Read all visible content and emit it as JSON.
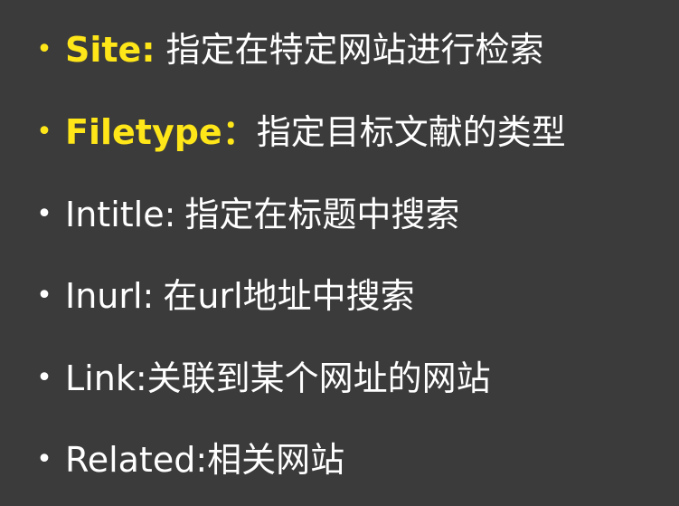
{
  "items": [
    {
      "bullet": "•",
      "keyword": "Site:",
      "text": "指定在特定网站进行检索"
    },
    {
      "bullet": "•",
      "keyword": "Filetype：",
      "text": "指定目标文献的类型"
    },
    {
      "bullet": "•",
      "keyword": "Intitle:",
      "text": "指定在标题中搜索"
    },
    {
      "bullet": "•",
      "keyword": "Inurl:",
      "text": "在url地址中搜索"
    },
    {
      "bullet": "•",
      "keyword": "Link:",
      "text": "关联到某个网址的网站"
    },
    {
      "bullet": "•",
      "keyword": "Related:",
      "text": "相关网站"
    }
  ],
  "colors": {
    "background": "#3b3b3b",
    "highlight": "#ffe619",
    "text": "#ffffff"
  }
}
